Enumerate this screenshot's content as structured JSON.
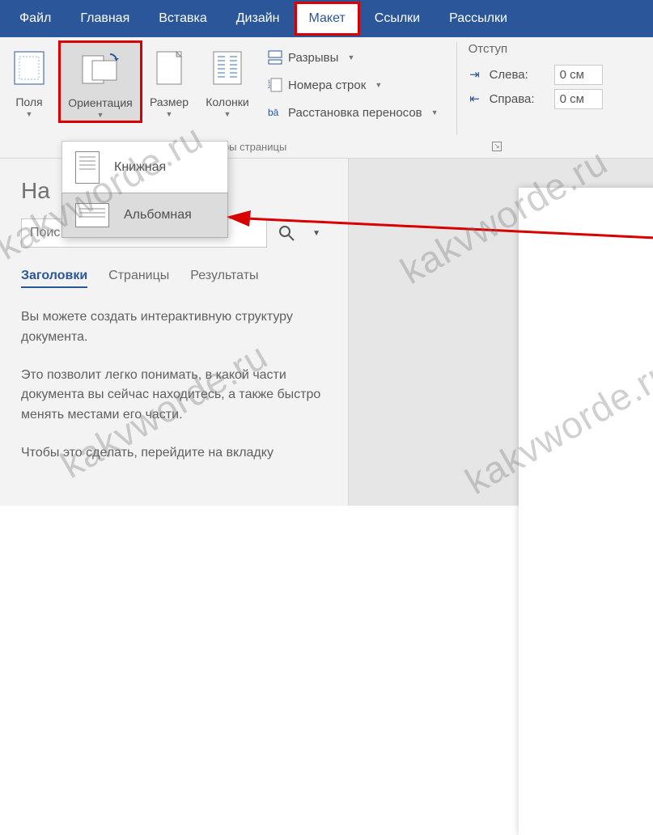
{
  "tabs": {
    "file": "Файл",
    "home": "Главная",
    "insert": "Вставка",
    "design": "Дизайн",
    "layout": "Макет",
    "references": "Ссылки",
    "mailings": "Рассылки"
  },
  "ribbon": {
    "margins": "Поля",
    "orientation": "Ориентация",
    "size": "Размер",
    "columns": "Колонки",
    "breaks": "Разрывы",
    "line_numbers": "Номера строк",
    "hyphenation": "Расстановка переносов",
    "page_setup_caption": "тры страницы",
    "indent_title": "Отступ",
    "indent_left_label": "Слева:",
    "indent_right_label": "Справа:",
    "indent_left_value": "0 см",
    "indent_right_value": "0 см"
  },
  "orientation_menu": {
    "portrait": "Книжная",
    "landscape": "Альбомная"
  },
  "nav": {
    "title_partial": "На",
    "search_placeholder": "Поис",
    "tab_headings": "Заголовки",
    "tab_pages": "Страницы",
    "tab_results": "Результаты",
    "body_p1": "Вы можете создать интерактивную структуру документа.",
    "body_p2": "Это позволит легко понимать, в какой части документа вы сейчас находитесь, а также быстро менять местами его части.",
    "body_p3": "Чтобы это сделать, перейдите на вкладку"
  },
  "watermark": "kakvworde.ru"
}
